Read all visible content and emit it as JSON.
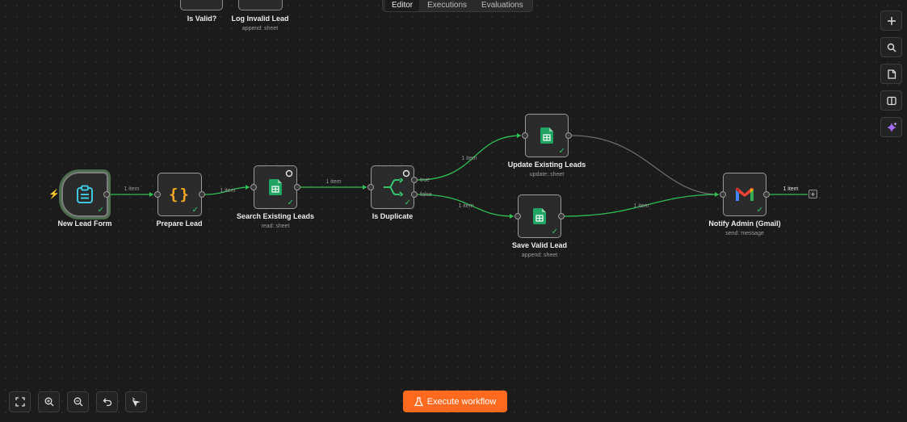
{
  "tabs": [
    {
      "label": "Editor",
      "active": true
    },
    {
      "label": "Executions",
      "active": false
    },
    {
      "label": "Evaluations",
      "active": false
    }
  ],
  "partial_nodes": [
    {
      "title": "Is Valid?",
      "subtitle": ""
    },
    {
      "title": "Log Invalid Lead",
      "subtitle": "append: sheet"
    }
  ],
  "nodes": {
    "new_lead_form": {
      "title": "New Lead Form",
      "subtitle": "",
      "icon": "clipboard-icon"
    },
    "prepare_lead": {
      "title": "Prepare Lead",
      "subtitle": "",
      "icon": "code-braces-icon"
    },
    "search_existing_leads": {
      "title": "Search Existing Leads",
      "subtitle": "read: sheet",
      "icon": "google-sheets-icon"
    },
    "is_duplicate": {
      "title": "Is Duplicate",
      "subtitle": "",
      "icon": "if-branch-icon"
    },
    "update_existing_leads": {
      "title": "Update Existing Leads",
      "subtitle": "update: sheet",
      "icon": "google-sheets-icon"
    },
    "save_valid_lead": {
      "title": "Save Valid Lead",
      "subtitle": "append: sheet",
      "icon": "google-sheets-icon"
    },
    "notify_admin": {
      "title": "Notify Admin (Gmail)",
      "subtitle": "send: message",
      "icon": "gmail-icon"
    }
  },
  "connections": {
    "c1": "1 item",
    "c2": "1 item",
    "c3": "1 item",
    "c4": "1 item",
    "c5": "1 item",
    "c6": "1 item",
    "c7": "1 item",
    "true_label": "true",
    "false_label": "false"
  },
  "right_toolbar": [
    "add-node-icon",
    "search-icon",
    "sticky-note-icon",
    "panel-toggle-icon",
    "ai-sparkle-icon"
  ],
  "bottom_toolbar": [
    "fit-view-icon",
    "zoom-in-icon",
    "zoom-out-icon",
    "undo-icon",
    "tidy-up-icon"
  ],
  "execute_button": {
    "label": "Execute workflow"
  },
  "colors": {
    "accent": "#ff6a1f",
    "success": "#35c26d",
    "sheets": "#1fa463",
    "wire": "#2fbf55"
  }
}
